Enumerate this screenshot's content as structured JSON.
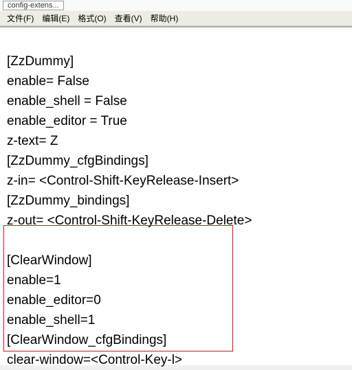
{
  "titlebar": {
    "label": "config-extens..."
  },
  "menu": {
    "file": "文件(F)",
    "edit": "编辑(E)",
    "format": "格式(O)",
    "view": "查看(V)",
    "help": "帮助(H)"
  },
  "content": {
    "line1": "[ZzDummy]",
    "line2": "enable= False",
    "line3": "enable_shell = False",
    "line4": "enable_editor = True",
    "line5": "z-text= Z",
    "line6": "[ZzDummy_cfgBindings]",
    "line7": "z-in= <Control-Shift-KeyRelease-Insert>",
    "line8": "[ZzDummy_bindings]",
    "line9": "z-out= <Control-Shift-KeyRelease-Delete>",
    "line10": "",
    "line11": "[ClearWindow]",
    "line12": "enable=1",
    "line13": "enable_editor=0",
    "line14": "enable_shell=1",
    "line15": "[ClearWindow_cfgBindings]",
    "line16": "clear-window=<Control-Key-l>"
  }
}
